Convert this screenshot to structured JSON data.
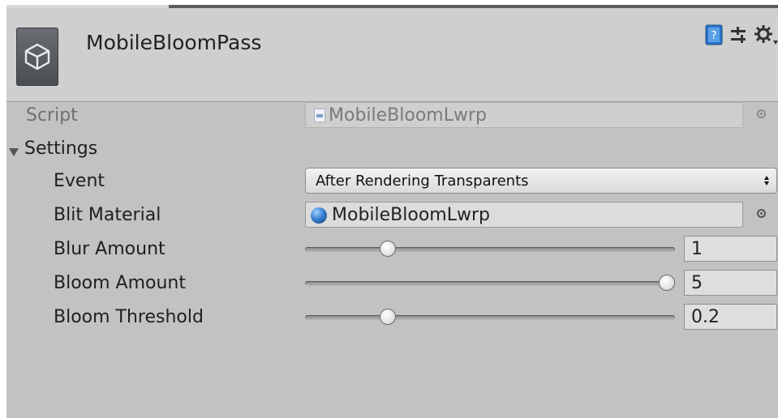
{
  "component": {
    "title": "MobileBloomPass",
    "header_icons": [
      "help-book-icon",
      "sliders-icon",
      "gear-icon"
    ]
  },
  "script": {
    "label": "Script",
    "value": "MobileBloomLwrp",
    "icon": "script-file-icon"
  },
  "settings": {
    "label": "Settings",
    "expanded": true,
    "event": {
      "label": "Event",
      "selected": "After Rendering Transparents"
    },
    "blit_material": {
      "label": "Blit Material",
      "value": "MobileBloomLwrp",
      "icon": "material-sphere-icon"
    },
    "blur_amount": {
      "label": "Blur Amount",
      "value": "1",
      "slider_fraction": 0.21
    },
    "bloom_amount": {
      "label": "Bloom Amount",
      "value": "5",
      "slider_fraction": 1.0
    },
    "bloom_threshold": {
      "label": "Bloom Threshold",
      "value": "0.2",
      "slider_fraction": 0.21
    }
  },
  "colors": {
    "panel_bg": "#c2c2c2",
    "header_bg": "#cfcfcf",
    "help_icon_blue": "#2a73c8"
  }
}
